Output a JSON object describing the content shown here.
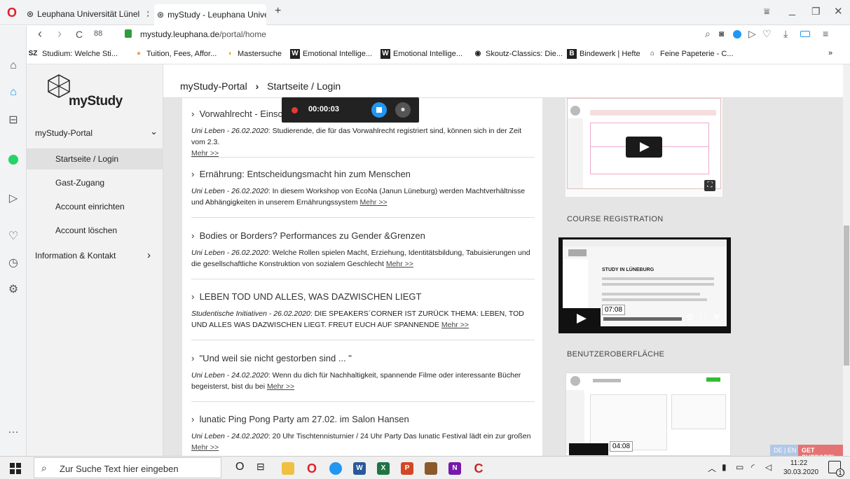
{
  "browser": {
    "tabs": [
      {
        "label": "Leuphana Universität Lünel"
      },
      {
        "label": "myStudy - Leuphana Unive"
      }
    ],
    "new_tab": "+",
    "url_domain": "mystudy.leuphana.de",
    "url_path": "/portal/home",
    "nav": {
      "back": "‹",
      "forward": "›",
      "reload": "C",
      "grid": "88"
    },
    "bookmarks": [
      {
        "icon": "SZ",
        "label": "Studium: Welche Sti..."
      },
      {
        "icon": "●",
        "label": "Tuition, Fees, Affor..."
      },
      {
        "icon": "◖",
        "label": "Mastersuche"
      },
      {
        "icon": "W",
        "label": "Emotional Intellige..."
      },
      {
        "icon": "W",
        "label": "Emotional Intellige..."
      },
      {
        "icon": "◉",
        "label": "Skoutz-Classics: Die..."
      },
      {
        "icon": "B",
        "label": "Bindewerk | Hefte"
      },
      {
        "icon": "⌂",
        "label": "Feine Papeterie - C..."
      }
    ],
    "bookmarks_more": "»"
  },
  "sidebar": {
    "logo_text": "myStudy",
    "items": [
      {
        "label": "myStudy-Portal",
        "chevron": "⌄"
      },
      {
        "label": "Startseite / Login"
      },
      {
        "label": "Gast-Zugang"
      },
      {
        "label": "Account einrichten"
      },
      {
        "label": "Account löschen"
      },
      {
        "label": "Information & Kontakt",
        "chevron": "›"
      }
    ]
  },
  "header": {
    "crumb1": "myStudy-Portal",
    "sep": "›",
    "crumb2": "Startseite / Login"
  },
  "recorder": {
    "time": "00:00:03"
  },
  "news": [
    {
      "title": "Vorwahlrecht - Einsc",
      "meta": "Uni Leben - 26.02.2020",
      "text": ": Studierende, die für das Vorwahlrecht registriert sind, können sich in der Zeit vom 2.3.",
      "more": "Mehr >>"
    },
    {
      "title": "Ernährung: Entscheidungsmacht hin zum Menschen",
      "meta": "Uni Leben - 26.02.2020",
      "text": ": In diesem Workshop von EcoNa (Janun Lüneburg) werden Machtverhältnisse und Abhängigkeiten in unserem Ernährungssystem",
      "more": "Mehr >>"
    },
    {
      "title": "Bodies or Borders? Performances zu Gender &Grenzen",
      "meta": "Uni Leben - 26.02.2020",
      "text": ": Welche Rollen spielen Macht, Erziehung, Identitätsbildung, Tabuisierungen und die gesellschaftliche Konstruktion von sozialem Geschlecht",
      "more": "Mehr >>"
    },
    {
      "title": "LEBEN TOD UND ALLES, WAS DAZWISCHEN LIEGT",
      "meta": "Studentische Initiativen - 26.02.2020",
      "text": ": DIE SPEAKERS´CORNER IST ZURÜCK THEMA: LEBEN, TOD UND ALLES WAS DAZWISCHEN LIEGT. FREUT EUCH AUF SPANNENDE",
      "more": "Mehr >>"
    },
    {
      "title": "\"Und weil sie nicht gestorben sind ... \"",
      "meta": "Uni Leben - 24.02.2020",
      "text": ": Wenn du dich für Nachhaltigkeit, spannende Filme oder interessante Bücher begeisterst, bist du bei",
      "more": "Mehr >>"
    },
    {
      "title": "lunatic Ping Pong Party am 27.02. im Salon Hansen",
      "meta": "Uni Leben - 24.02.2020",
      "text": ": 20 Uhr Tischtennisturnier / 24 Uhr Party Das lunatic Festival lädt ein zur großen",
      "more": "Mehr >>"
    }
  ],
  "videos": {
    "section2": "COURSE REGISTRATION",
    "section3": "BENUTZEROBERFLÄCHE",
    "v2_time": "07:08",
    "v3_time": "04:08",
    "v2_page_heading": "STUDY IN LÜNEBURG"
  },
  "floating": {
    "lang": "DE | EN",
    "support": "GET SUPPORT!"
  },
  "taskbar": {
    "search_placeholder": "Zur Suche Text hier eingeben",
    "time": "11:22",
    "date": "30.03.2020",
    "notif_count": "1"
  },
  "colors": {
    "accent": "#2196f3",
    "record": "#e53935",
    "support": "#e57373"
  }
}
